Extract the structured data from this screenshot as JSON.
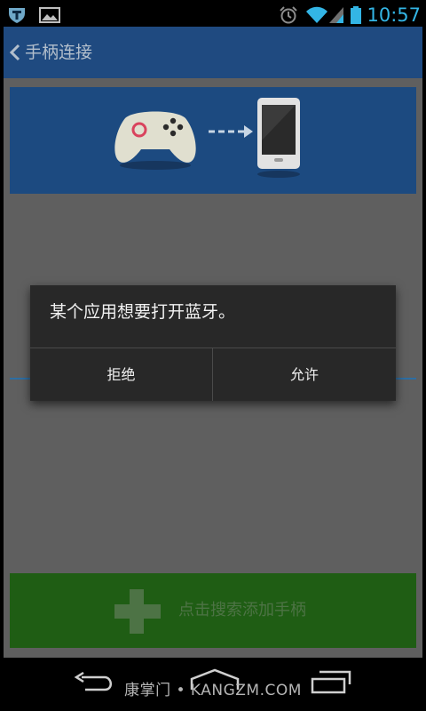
{
  "status_bar": {
    "time": "10:57",
    "icons": [
      "app-t-icon",
      "image-notification-icon",
      "alarm-icon",
      "wifi-icon",
      "signal-icon",
      "battery-icon"
    ],
    "time_color": "#33b5e5"
  },
  "action_bar": {
    "title": "手柄连接",
    "back_icon": "chevron-left-icon",
    "color": "#1f4a80"
  },
  "banner": {
    "icons": [
      "gamepad-icon",
      "arrow-right-icon",
      "smartphone-icon"
    ]
  },
  "add_bar": {
    "label": "点击搜索添加手柄",
    "icon": "plus-icon",
    "color": "#1f5d14"
  },
  "dialog": {
    "message": "某个应用想要打开蓝牙。",
    "deny_label": "拒绝",
    "allow_label": "允许"
  },
  "nav_bar": {
    "buttons": [
      "back-icon",
      "home-icon",
      "recent-apps-icon"
    ]
  },
  "watermark": {
    "text": "康掌门 • KANGZM.COM"
  }
}
